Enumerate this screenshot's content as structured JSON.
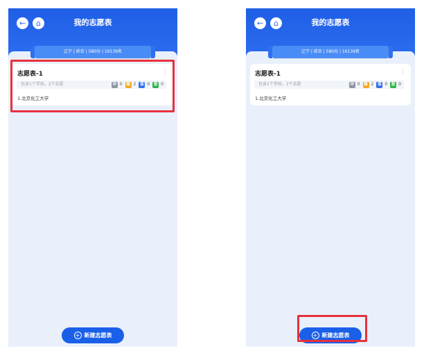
{
  "screens": [
    {
      "title": "我的志愿表",
      "ribbon": "辽宁 | 综合 | 580分 | 16139名",
      "card": {
        "title": "志愿表-1",
        "more": "⋮",
        "summary": "包含1个学校，2个志愿",
        "tags": [
          {
            "label": "冲",
            "count": "0",
            "color": "#8c95a3"
          },
          {
            "label": "稳",
            "count": "2",
            "color": "#f5a623"
          },
          {
            "label": "保",
            "count": "0",
            "color": "#2f6ff0"
          },
          {
            "label": "垫",
            "count": "0",
            "color": "#2fb34a"
          }
        ],
        "school": "1.北京化工大学"
      },
      "new_button": "新建志愿表"
    },
    {
      "title": "我的志愿表",
      "ribbon": "辽宁 | 综合 | 580分 | 16139名",
      "card": {
        "title": "志愿表-1",
        "more": "⋮",
        "summary": "包含1个学校，2个志愿",
        "tags": [
          {
            "label": "冲",
            "count": "0",
            "color": "#8c95a3"
          },
          {
            "label": "稳",
            "count": "2",
            "color": "#f5a623"
          },
          {
            "label": "保",
            "count": "0",
            "color": "#2f6ff0"
          },
          {
            "label": "垫",
            "count": "0",
            "color": "#2fb34a"
          }
        ],
        "school": "1.北京化工大学"
      },
      "new_button": "新建志愿表"
    }
  ],
  "icons": {
    "back": "←",
    "home": "⌂",
    "plus": "+"
  },
  "colors": {
    "header_blue": "#2f6ff0",
    "button_blue": "#1a5fe8",
    "highlight_red": "#e8303d",
    "background": "#e9f0fb"
  }
}
